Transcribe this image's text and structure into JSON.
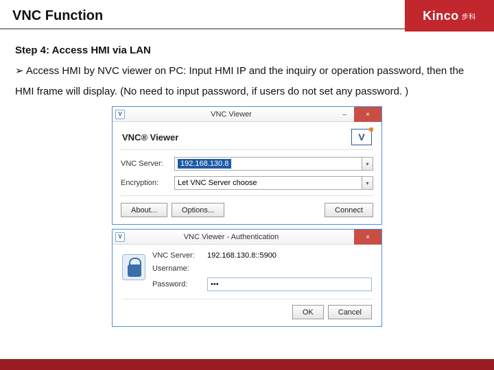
{
  "header": {
    "title": "VNC Function",
    "logo_text": "Kinco",
    "logo_sub": "步科"
  },
  "doc": {
    "step_line": "Step 4: Access HMI via LAN",
    "bullet_prefix": "➢",
    "body_text": "Access HMI by NVC viewer on PC: Input HMI IP and the inquiry or operation password, then the HMI frame will display. (No need to input password, if users do not set any password. )"
  },
  "dialog1": {
    "icon_text": "V",
    "title": "VNC Viewer",
    "minimize": "–",
    "close": "×",
    "brand": "VNC® Viewer",
    "vnc_logo_text": "V",
    "server_label": "VNC Server:",
    "server_value": "192.168.130.8",
    "enc_label": "Encryption:",
    "enc_value": "Let VNC Server choose",
    "btn_about": "About...",
    "btn_options": "Options...",
    "btn_connect": "Connect"
  },
  "dialog2": {
    "icon_text": "V",
    "title": "VNC Viewer - Authentication",
    "close": "×",
    "server_label": "VNC Server:",
    "server_value": "192.168.130.8::5900",
    "user_label": "Username:",
    "user_value": "",
    "pw_label": "Password:",
    "pw_value": "•••",
    "btn_ok": "OK",
    "btn_cancel": "Cancel"
  }
}
